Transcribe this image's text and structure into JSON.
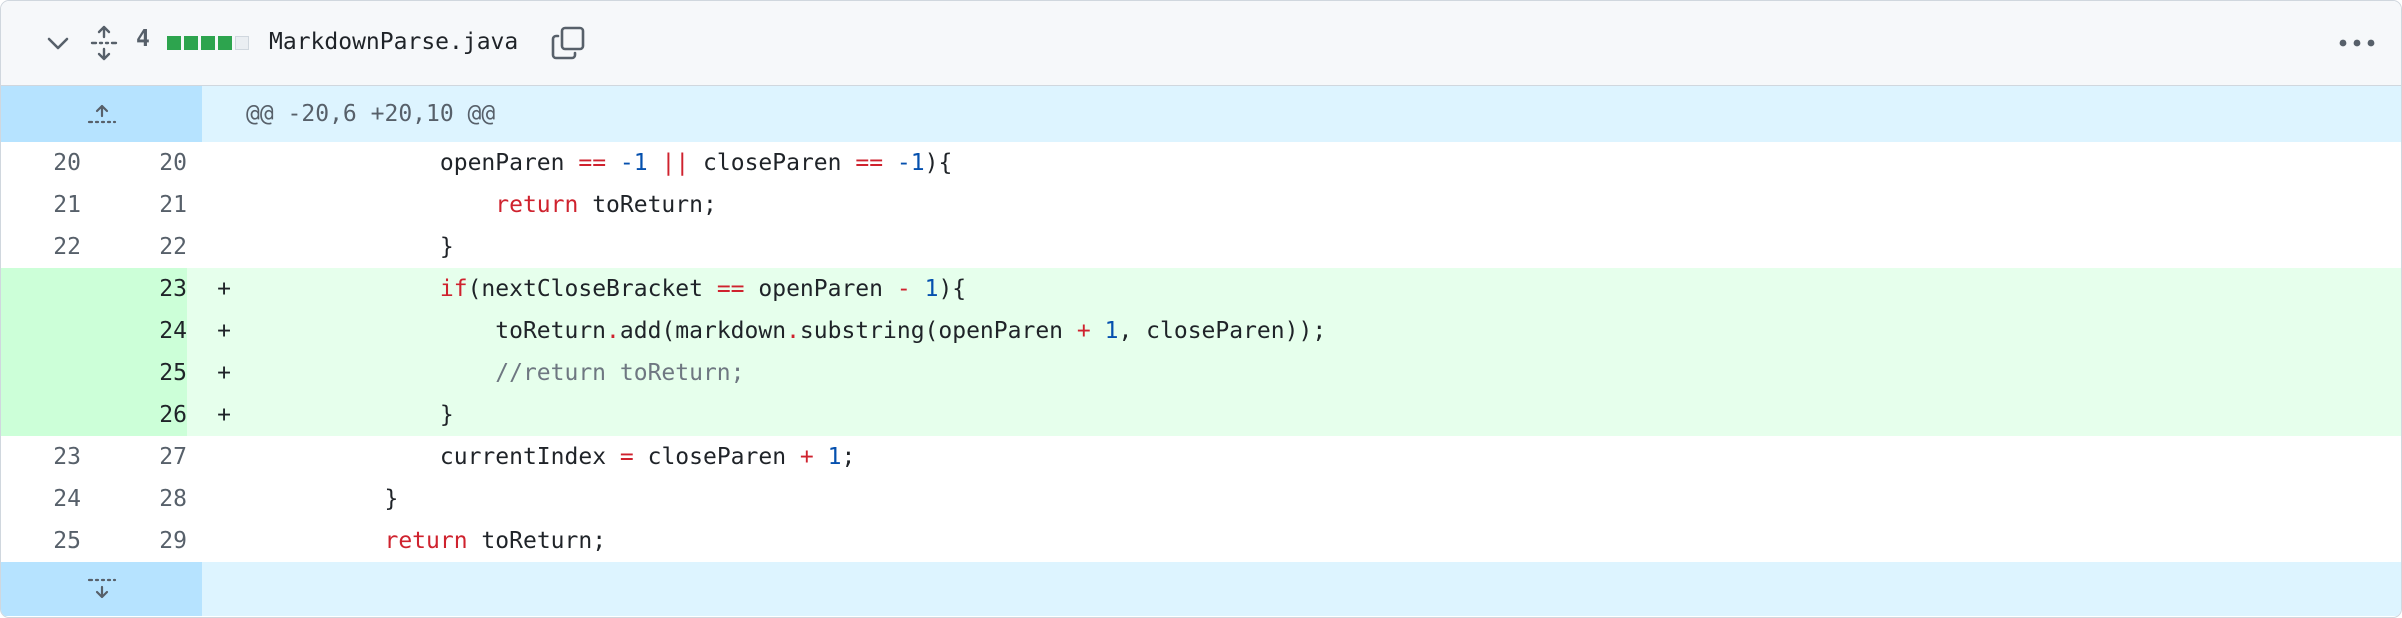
{
  "header": {
    "changes_count": "4",
    "diffstat": {
      "additions": 4,
      "deletions": 0,
      "neutral": 1
    },
    "file_name": "MarkdownParse.java"
  },
  "hunk": {
    "label": "@@ -20,6 +20,10 @@"
  },
  "lines": [
    {
      "type": "context",
      "old": "20",
      "new": "20"
    },
    {
      "type": "context",
      "old": "21",
      "new": "21"
    },
    {
      "type": "context",
      "old": "22",
      "new": "22"
    },
    {
      "type": "add",
      "old": "",
      "new": "23",
      "marker": "+"
    },
    {
      "type": "add",
      "old": "",
      "new": "24",
      "marker": "+"
    },
    {
      "type": "add",
      "old": "",
      "new": "25",
      "marker": "+"
    },
    {
      "type": "add",
      "old": "",
      "new": "26",
      "marker": "+"
    },
    {
      "type": "context",
      "old": "23",
      "new": "27"
    },
    {
      "type": "context",
      "old": "24",
      "new": "28"
    },
    {
      "type": "context",
      "old": "25",
      "new": "29"
    }
  ],
  "code": {
    "l0": {
      "t1": "openParen ",
      "t2": "==",
      "t3": " ",
      "t4": "-1",
      "t5": " ",
      "t6": "||",
      "t7": " closeParen ",
      "t8": "==",
      "t9": " ",
      "t10": "-1",
      "t11": "){"
    },
    "l1": {
      "t1": "return",
      "t2": " toReturn;"
    },
    "l2": {
      "t1": "}"
    },
    "l3": {
      "t1": "if",
      "t2": "(nextCloseBracket ",
      "t3": "==",
      "t4": " openParen ",
      "t5": "-",
      "t6": " ",
      "t7": "1",
      "t8": "){"
    },
    "l4": {
      "t1": "toReturn",
      "t2": ".",
      "t3": "add(markdown",
      "t4": ".",
      "t5": "substring(openParen ",
      "t6": "+",
      "t7": " ",
      "t8": "1",
      "t9": ", closeParen));"
    },
    "l5": {
      "t1": "//return toReturn;"
    },
    "l6": {
      "t1": "}"
    },
    "l7": {
      "t1": "currentIndex ",
      "t2": "=",
      "t3": " closeParen ",
      "t4": "+",
      "t5": " ",
      "t6": "1",
      "t7": ";"
    },
    "l8": {
      "t1": "}"
    },
    "l9": {
      "t1": "return",
      "t2": " toReturn;"
    }
  },
  "icons": {
    "collapse": "chevron-down-icon",
    "expand_all": "unfold-icon",
    "copy": "copy-icon",
    "more": "kebab-horizontal-icon",
    "expand_up": "fold-up-icon",
    "expand_down": "fold-down-icon"
  },
  "colors": {
    "addition_bg": "#e6ffec",
    "addition_num_bg": "#ccffd8",
    "hunk_bg": "#ddf4ff",
    "hunk_gutter_bg": "#b6e3ff",
    "keyword": "#cf222e",
    "number": "#0550ae",
    "comment": "#6e7781"
  }
}
